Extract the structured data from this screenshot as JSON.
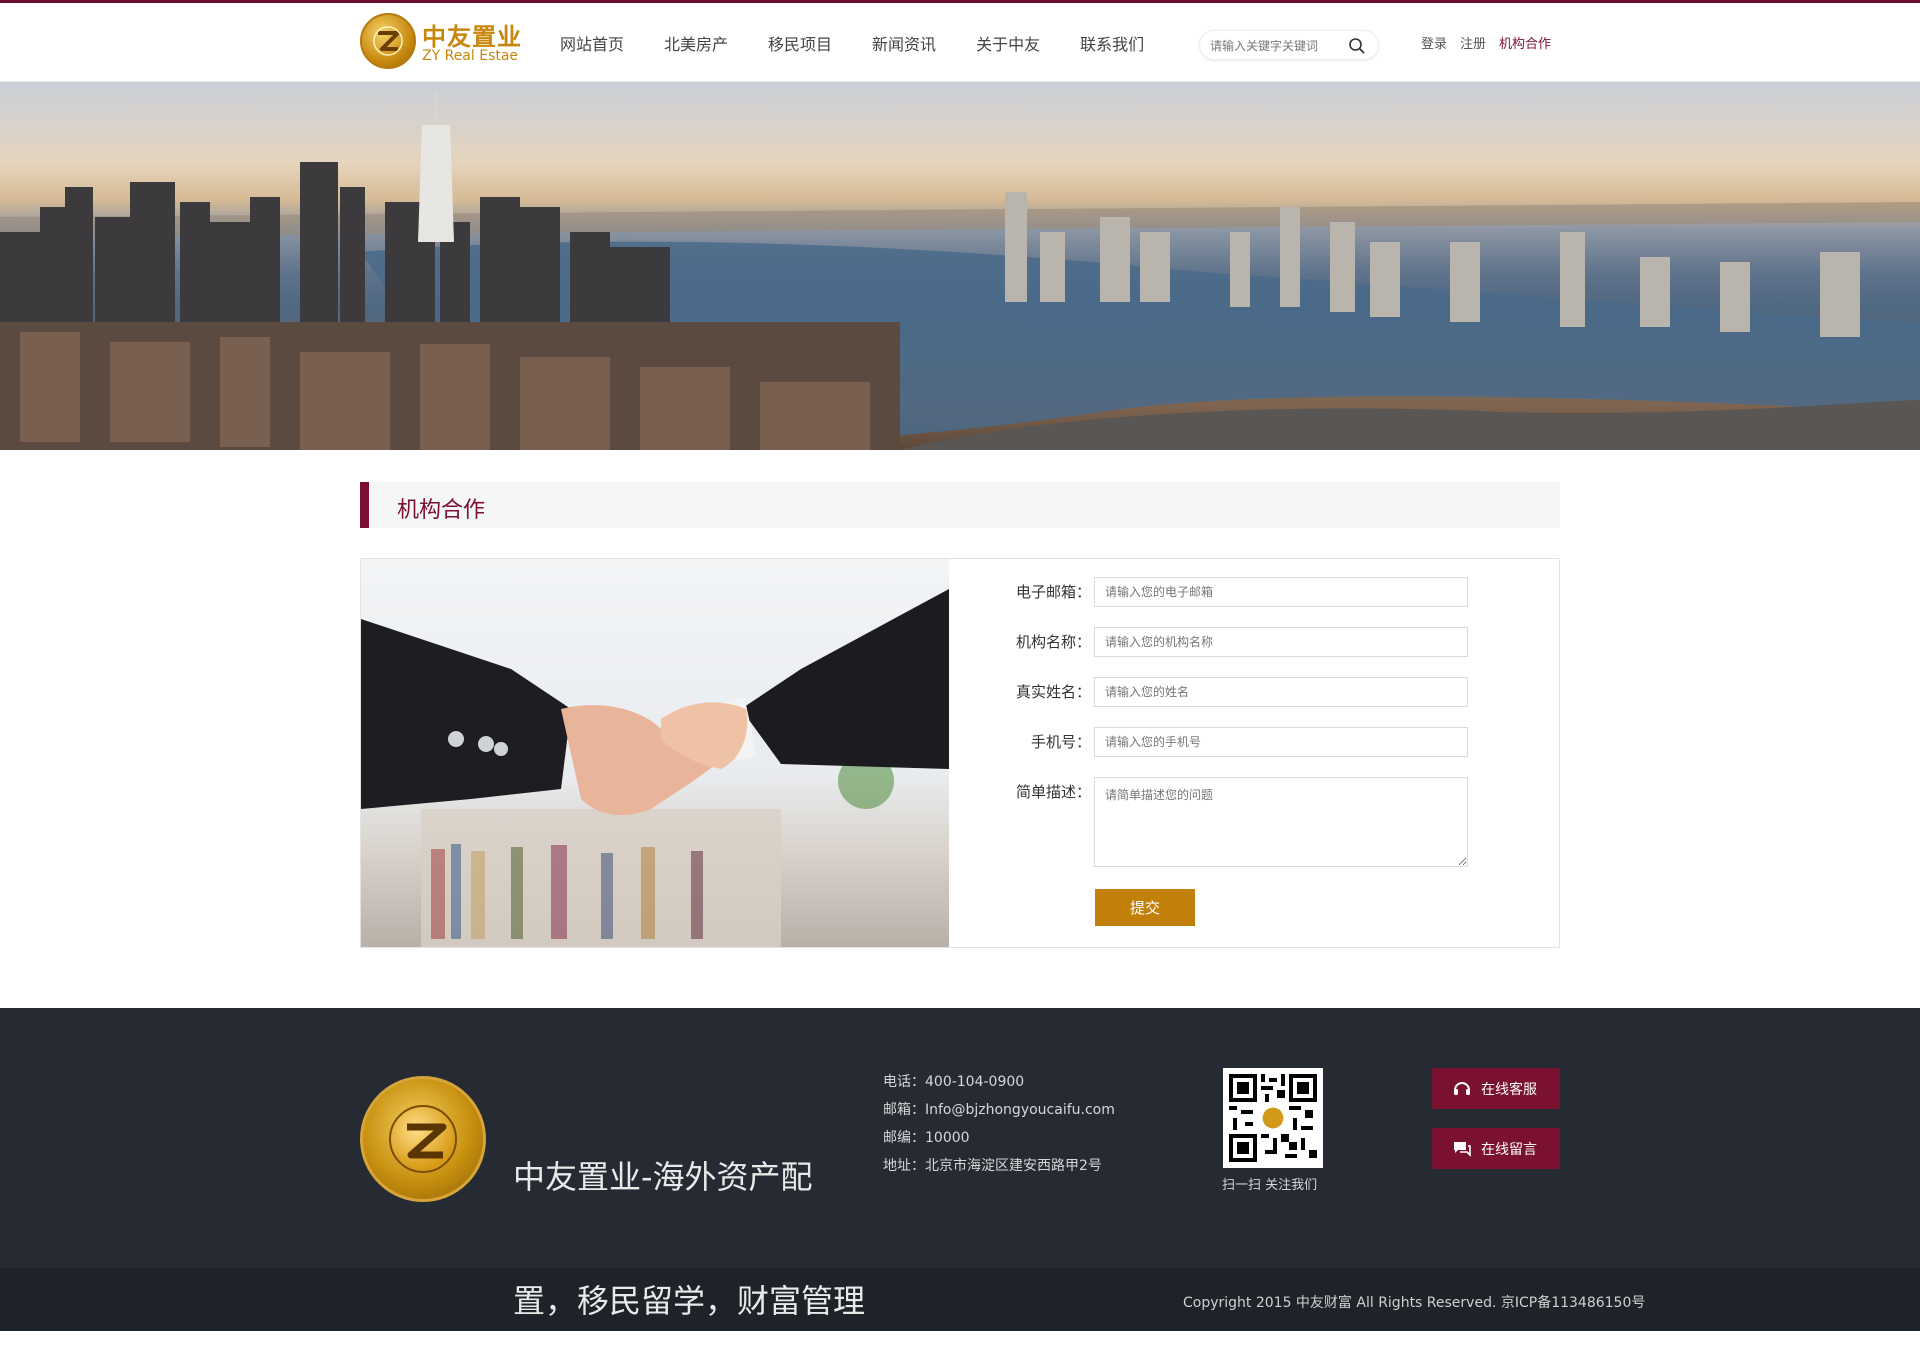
{
  "header": {
    "logo_cn": "中友置业",
    "logo_en": "ZY Real Estae",
    "nav": [
      "网站首页",
      "北美房产",
      "移民项目",
      "新闻资讯",
      "关于中友",
      "联系我们"
    ],
    "search_placeholder": "请输入关键字关键词",
    "account": {
      "login": "登录",
      "register": "注册",
      "partner": "机构合作"
    }
  },
  "section": {
    "title": "机构合作"
  },
  "form": {
    "fields": [
      {
        "label": "电子邮箱：",
        "placeholder": "请输入您的电子邮箱"
      },
      {
        "label": "机构名称：",
        "placeholder": "请输入您的机构名称"
      },
      {
        "label": "真实姓名：",
        "placeholder": "请输入您的姓名"
      },
      {
        "label": "手机号：",
        "placeholder": "请输入您的手机号"
      }
    ],
    "description": {
      "label": "简单描述：",
      "placeholder": "请简单描述您的问题"
    },
    "submit": "提交"
  },
  "footer": {
    "slogan": "中友置业-海外资产配置，移民留学，财富管理",
    "contact": {
      "phone": "电话：400-104-0900",
      "email": "邮箱：Info@bjzhongyoucaifu.com",
      "postcode": "邮编：10000",
      "address": "地址：北京市海淀区建安西路甲2号"
    },
    "qr_caption": "扫一扫 关注我们",
    "buttons": {
      "service": "在线客服",
      "message": "在线留言"
    },
    "copyright": "Copyright 2015 中友财富 All Rights Reserved. 京ICP备113486150号"
  },
  "colors": {
    "brand": "#7a1131",
    "gold": "#c27f0a",
    "footer_bg": "#262b33"
  },
  "icons": [
    "logo-emblem-icon",
    "search-icon",
    "headset-icon",
    "chat-bubble-icon",
    "qr-code"
  ]
}
